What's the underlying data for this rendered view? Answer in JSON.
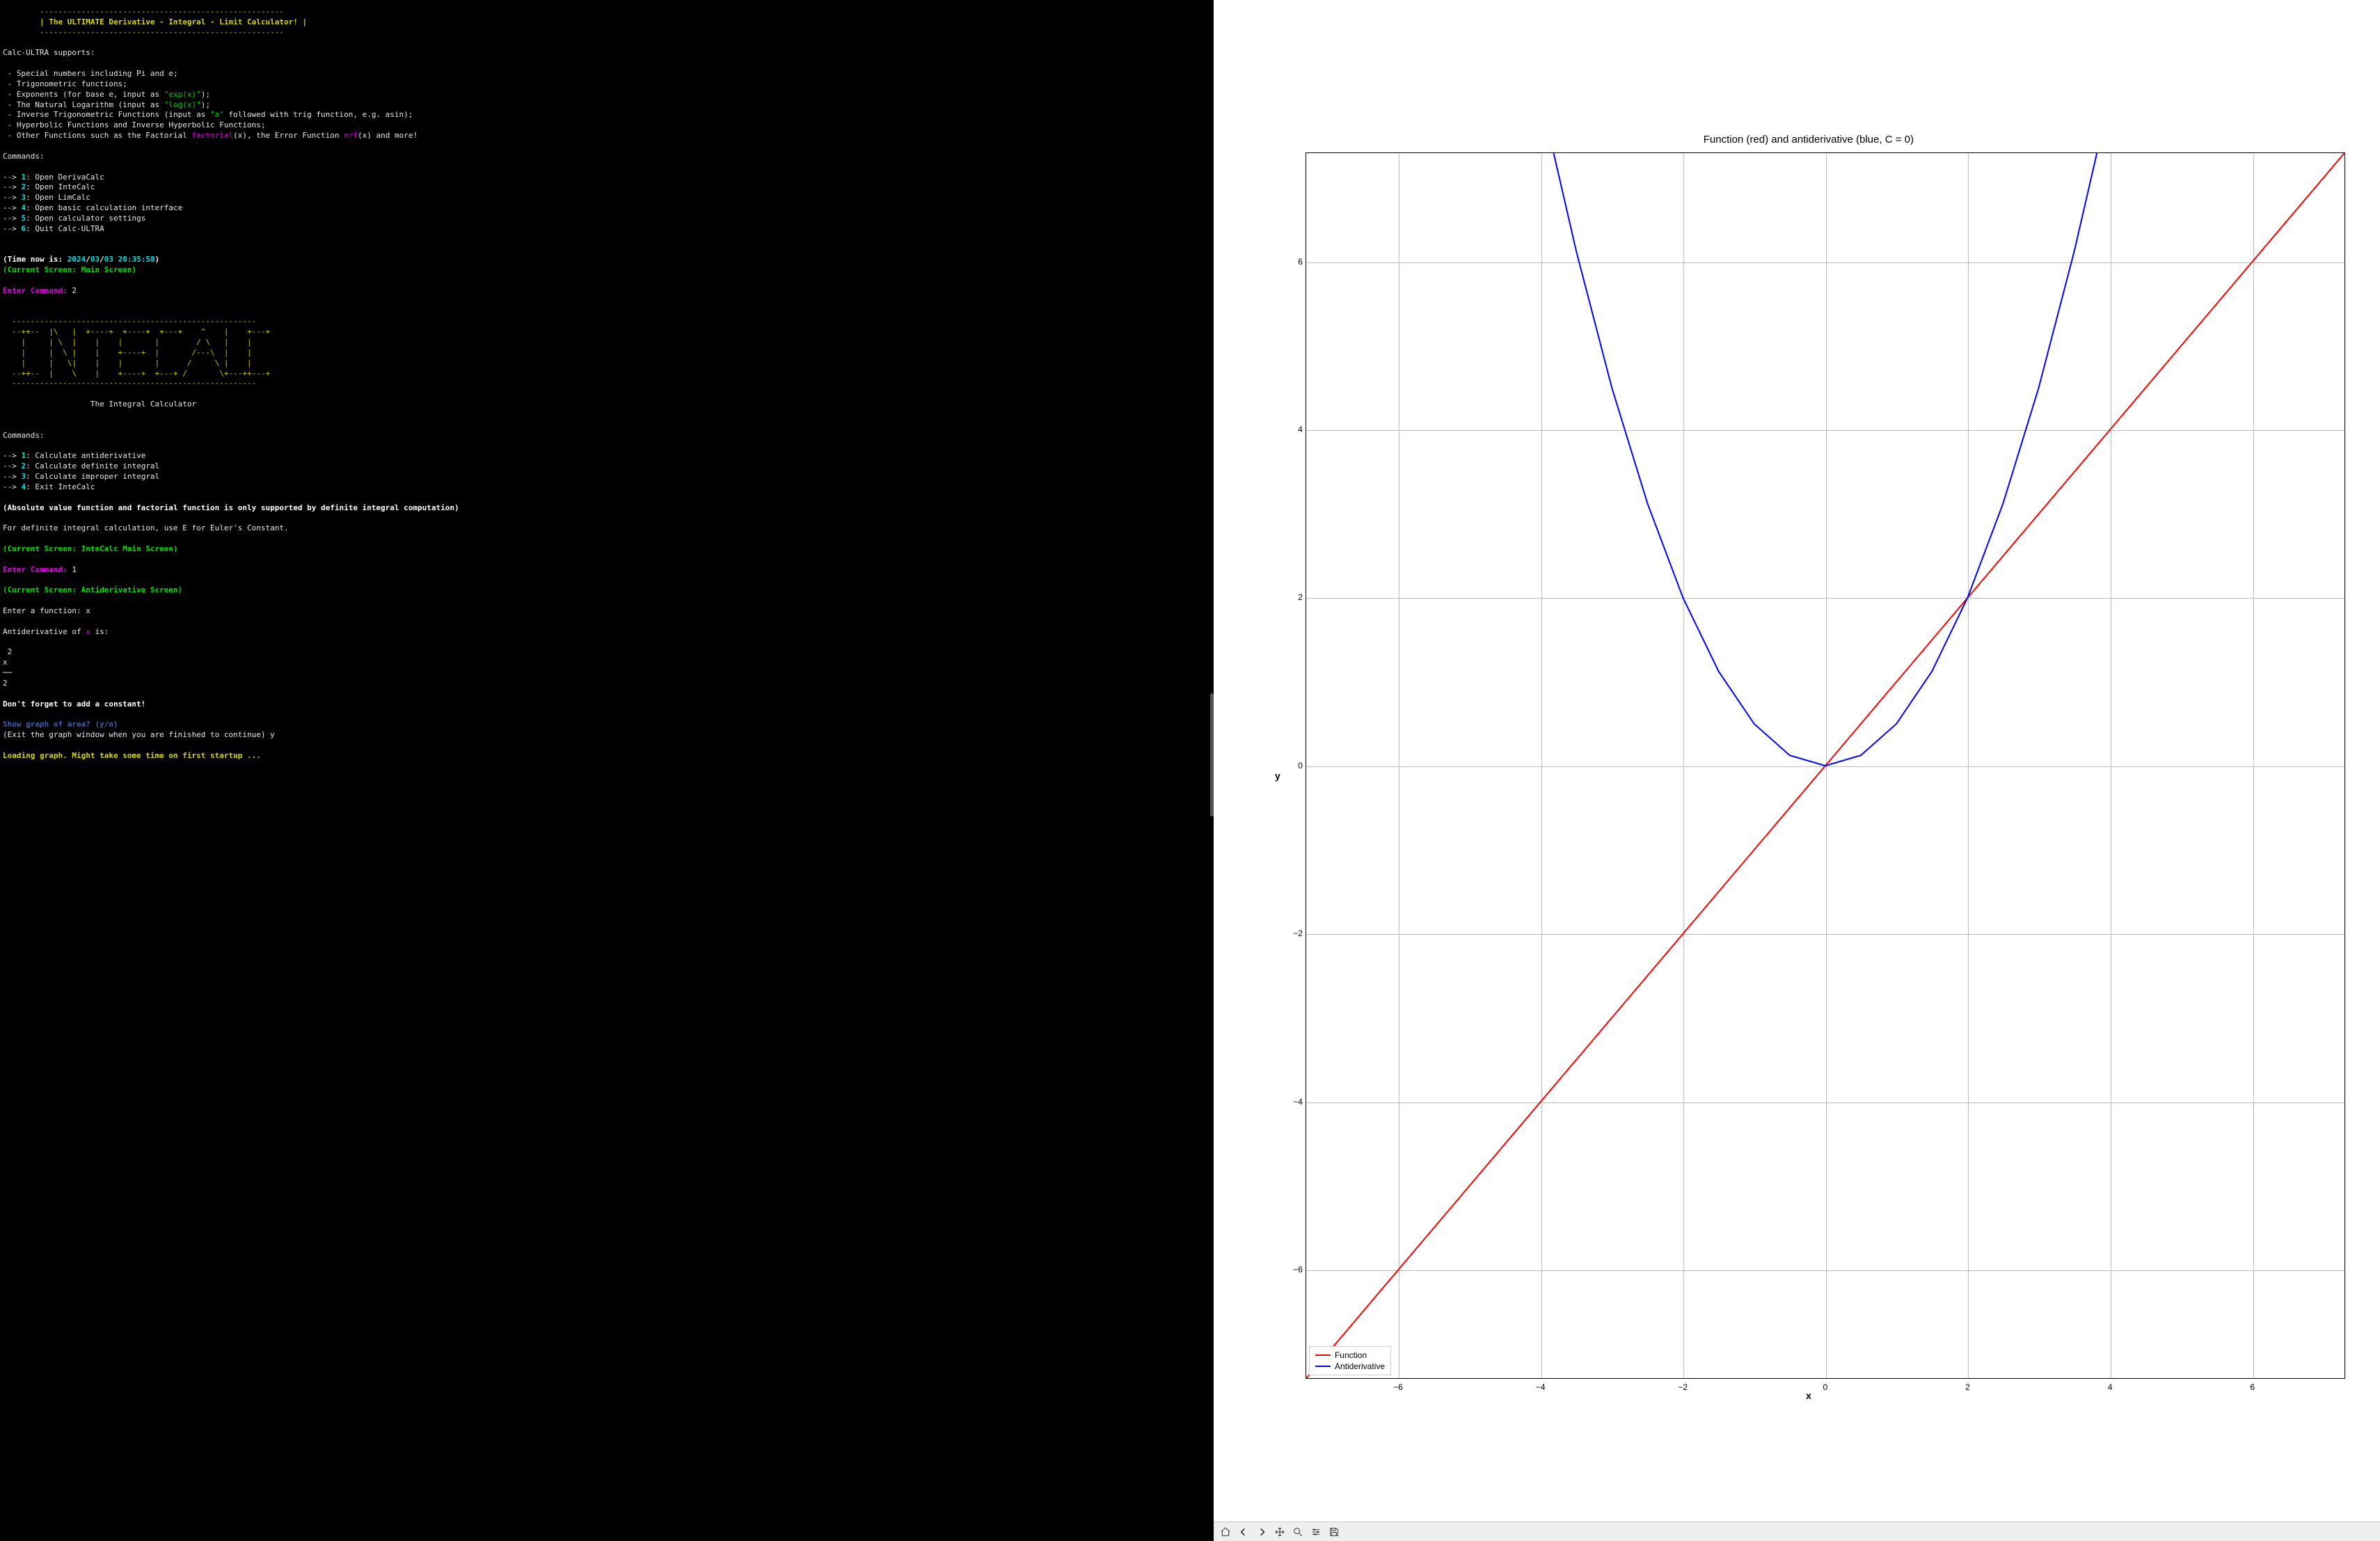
{
  "banner": {
    "rule": "        -----------------------------------------------------",
    "title": "        | The ULTIMATE Derivative - Integral - Limit Calculator! |"
  },
  "supports": {
    "heading": "Calc-ULTRA supports:",
    "line1_pre": " - Special numbers including Pi and e;",
    "line2_pre": " - Trigonometric functions;",
    "line3_pre": " - Exponents (for base e, input as ",
    "line3_code": "\"exp(x)\"",
    "line3_post": ");",
    "line4_pre": " - The Natural Logarithm (input as ",
    "line4_code": "\"log(x)\"",
    "line4_post": ");",
    "line5_pre": " - Inverse Trigonometric Functions (input as ",
    "line5_code": "\"a\"",
    "line5_post": " followed with trig function, e.g. asin);",
    "line6_pre": " - Hyperbolic Functions and Inverse Hyperbolic Functions;",
    "line7_pre": " - Other Functions such as the Factorial ",
    "line7_fn1": "factorial",
    "line7_mid": "(x), the Error Function ",
    "line7_fn2": "erf",
    "line7_post": "(x) and more!"
  },
  "commands1": {
    "heading": "Commands:",
    "items": [
      {
        "num": "1",
        "text": ": Open DerivaCalc"
      },
      {
        "num": "2",
        "text": ": Open InteCalc"
      },
      {
        "num": "3",
        "text": ": Open LimCalc"
      },
      {
        "num": "4",
        "text": ": Open basic calculation interface"
      },
      {
        "num": "5",
        "text": ": Open calculator settings"
      },
      {
        "num": "6",
        "text": ": Quit Calc-ULTRA"
      }
    ]
  },
  "time": {
    "pre": "(Time now is: ",
    "yyyy": "2024",
    "sep": "/",
    "mm": "03",
    "dd": "03",
    "time": " 20:35:58",
    "post": ")"
  },
  "screen1": "(Current Screen: Main Screen)",
  "prompt1": {
    "label": "Enter Command:",
    "value": " 2"
  },
  "intecalc_art": [
    "  -----------------------------------------------------",
    "  --++--  |\\   |  +----+  +----+  +---+    ^    |    +---+",
    "    |     | \\  |    |    |       |        / \\   |    |    ",
    "    |     |  \\ |    |    +----+  |       /---\\  |    |    ",
    "    |     |   \\|    |    |       |      /     \\ |    |    ",
    "  --++--  |    \\    |    +----+  +---+ /       \\+---++---+",
    "  -----------------------------------------------------"
  ],
  "intecalc_subtitle": "                   The Integral Calculator",
  "commands2": {
    "heading": "Commands:",
    "items": [
      {
        "num": "1",
        "text": ": Calculate antiderivative"
      },
      {
        "num": "2",
        "text": ": Calculate definite integral"
      },
      {
        "num": "3",
        "text": ": Calculate improper integral"
      },
      {
        "num": "4",
        "text": ": Exit InteCalc"
      }
    ]
  },
  "note_abs": "(Absolute value function and factorial function is only supported by definite integral computation)",
  "note_euler": "For definite integral calculation, use E for Euler's Constant.",
  "screen2": "(Current Screen: InteCalc Main Screen)",
  "prompt2": {
    "label": "Enter Command:",
    "value": " 1"
  },
  "screen3": "(Current Screen: Antiderivative Screen)",
  "enter_fn": {
    "label": "Enter a function:",
    "value": " x"
  },
  "antideriv": {
    "pre": "Antiderivative of ",
    "var": "x",
    "post": " is:"
  },
  "result": {
    "top": " 2",
    "mid": "x ",
    "rule": "──",
    "bot": "2 "
  },
  "constant_note": "Don't forget to add a constant!",
  "show_graph": {
    "q": "Show graph of area? (y/n)",
    "hint": "(Exit the graph window when you are finished to continue)",
    "ans": " y"
  },
  "loading": "Loading graph. Might take some time on first startup ...",
  "chart_data": {
    "type": "line",
    "title": "Function (red) and antiderivative (blue, C = 0)",
    "xlabel": "x",
    "ylabel": "y",
    "xlim": [
      -7.3,
      7.3
    ],
    "ylim": [
      -7.3,
      7.3
    ],
    "xticks": [
      -6,
      -4,
      -2,
      0,
      2,
      4,
      6
    ],
    "yticks": [
      -6,
      -4,
      -2,
      0,
      2,
      4,
      6
    ],
    "series": [
      {
        "name": "Function",
        "color": "#ff0000",
        "expression": "y = x",
        "x": [
          -7.3,
          7.3
        ],
        "y": [
          -7.3,
          7.3
        ]
      },
      {
        "name": "Antiderivative",
        "color": "#0000ff",
        "expression": "y = x^2 / 2",
        "x": [
          -3.82,
          -3.5,
          -3,
          -2.5,
          -2,
          -1.5,
          -1,
          -0.5,
          0,
          0.5,
          1,
          1.5,
          2,
          2.5,
          3,
          3.5,
          3.82
        ],
        "y": [
          7.3,
          6.125,
          4.5,
          3.125,
          2,
          1.125,
          0.5,
          0.125,
          0,
          0.125,
          0.5,
          1.125,
          2,
          3.125,
          4.5,
          6.125,
          7.3
        ]
      }
    ],
    "legend": [
      "Function",
      "Antiderivative"
    ]
  },
  "toolbar": {
    "home": "Home",
    "back": "Back",
    "forward": "Forward",
    "pan": "Pan",
    "zoom": "Zoom",
    "config": "Configure",
    "save": "Save"
  }
}
